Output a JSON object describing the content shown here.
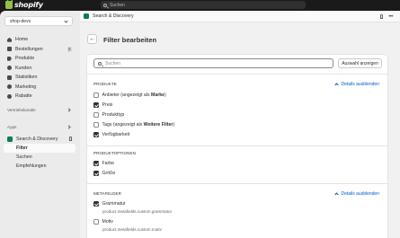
{
  "topbar": {
    "logo_text": "shopify",
    "search_placeholder": "Suchen"
  },
  "sidebar": {
    "store": "shop-devs",
    "items": [
      {
        "label": "Home",
        "icon": "home-icon"
      },
      {
        "label": "Bestellungen",
        "icon": "orders-icon",
        "badge": "2"
      },
      {
        "label": "Produkte",
        "icon": "tag-icon"
      },
      {
        "label": "Kunden",
        "icon": "person-icon"
      },
      {
        "label": "Statistiken",
        "icon": "chart-icon"
      },
      {
        "label": "Marketing",
        "icon": "target-icon"
      },
      {
        "label": "Rabatte",
        "icon": "discount-icon"
      }
    ],
    "sales_channels_label": "Vertriebskanäle",
    "apps_label": "Apps",
    "app": {
      "label": "Search & Discovery"
    },
    "subitems": [
      {
        "label": "Filter",
        "active": true
      },
      {
        "label": "Suchen",
        "active": false
      },
      {
        "label": "Empfehlungen",
        "active": false
      }
    ]
  },
  "appbar": {
    "title": "Search & Discovery"
  },
  "page": {
    "title": "Filter bearbeiten",
    "search_placeholder": "Suchen",
    "show_selection_label": "Auswahl anzeigen",
    "sections": [
      {
        "title": "PRODUKTE",
        "toggle_label": "Details ausblenden",
        "options": [
          {
            "label": "Anbieter (angezeigt als ",
            "bold": "Marke",
            "suffix": ")",
            "checked": false
          },
          {
            "label": "Preis",
            "checked": true
          },
          {
            "label": "Produkttyp",
            "checked": false
          },
          {
            "label": "Tags (angezeigt als ",
            "bold": "Weitere Filter",
            "suffix": ")",
            "checked": false
          },
          {
            "label": "Verfügbarkeit",
            "checked": true
          }
        ]
      },
      {
        "title": "PRODUKTOPTIONEN",
        "options": [
          {
            "label": "Farbe",
            "checked": true
          },
          {
            "label": "Größe",
            "checked": true
          }
        ]
      },
      {
        "title": "METAFELDER",
        "toggle_label": "Details ausblenden",
        "options": [
          {
            "label": "Grammatur",
            "checked": true,
            "sub": "product.metafields.custom.grammatur"
          },
          {
            "label": "Motiv",
            "checked": false,
            "sub": "product.metafields.custom.motiv"
          }
        ]
      }
    ]
  },
  "colors": {
    "topbar": "#1a1a1a",
    "sidebar": "#ebebeb",
    "main": "#f1f1f1",
    "link": "#005bd3",
    "brand": "#95bf47",
    "app_icon": "#0f7a5a"
  }
}
